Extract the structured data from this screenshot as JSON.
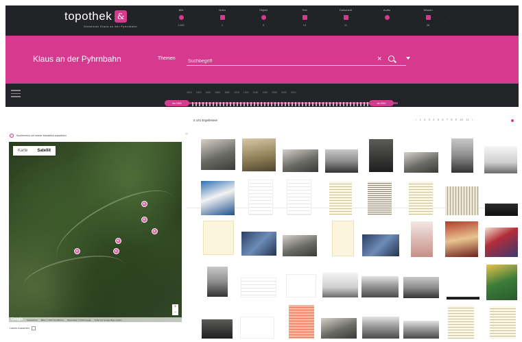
{
  "brand": {
    "name": "topothek",
    "mark": "&",
    "subtitle": "Gemeinde Klaus an der Pyhrnbahn"
  },
  "nav": [
    {
      "label": "Bild",
      "count": "1.891",
      "icon": "camera-icon"
    },
    {
      "label": "Video",
      "count": "1",
      "icon": "video-icon"
    },
    {
      "label": "Objekt",
      "count": "9",
      "icon": "object-icon"
    },
    {
      "label": "Text",
      "count": "13",
      "icon": "text-icon"
    },
    {
      "label": "Dokument",
      "count": "11",
      "icon": "document-icon"
    },
    {
      "label": "Audio",
      "count": "",
      "icon": "audio-icon"
    },
    {
      "label": "Wissen",
      "count": "36",
      "icon": "knowledge-icon"
    }
  ],
  "search": {
    "place": "Klaus an der Pyhrnbahn",
    "themes_label": "Themen",
    "placeholder": "Suchbegriff"
  },
  "timeline": {
    "years": [
      "1800",
      "1820",
      "1840",
      "1860",
      "1880",
      "1900",
      "1920",
      "1940",
      "1960",
      "1980",
      "2000",
      "2020"
    ],
    "start_label": "bis 1800",
    "end_label": "ab 2020"
  },
  "results": {
    "count_text": "2.141 Ergebnisse",
    "pages": [
      "1",
      "2",
      "3",
      "4",
      "5",
      "6",
      "7",
      "8",
      "9",
      "10",
      "11"
    ]
  },
  "map": {
    "notice": "Suchbereich mit meiner Mausklick auswählen",
    "tabs": [
      "Karte",
      "Satellit"
    ],
    "active_tab": "Satellit",
    "footer": [
      "Tastenkürzel",
      "Bilder © 2023 TerraMetrics",
      "Kartendaten © 2023 Google",
      "Fehler bei Google Maps melden"
    ],
    "google": "Google",
    "labels_toggle": "Labels Aussehen"
  },
  "colors": {
    "accent": "#d63a8f",
    "dark": "#222326"
  }
}
